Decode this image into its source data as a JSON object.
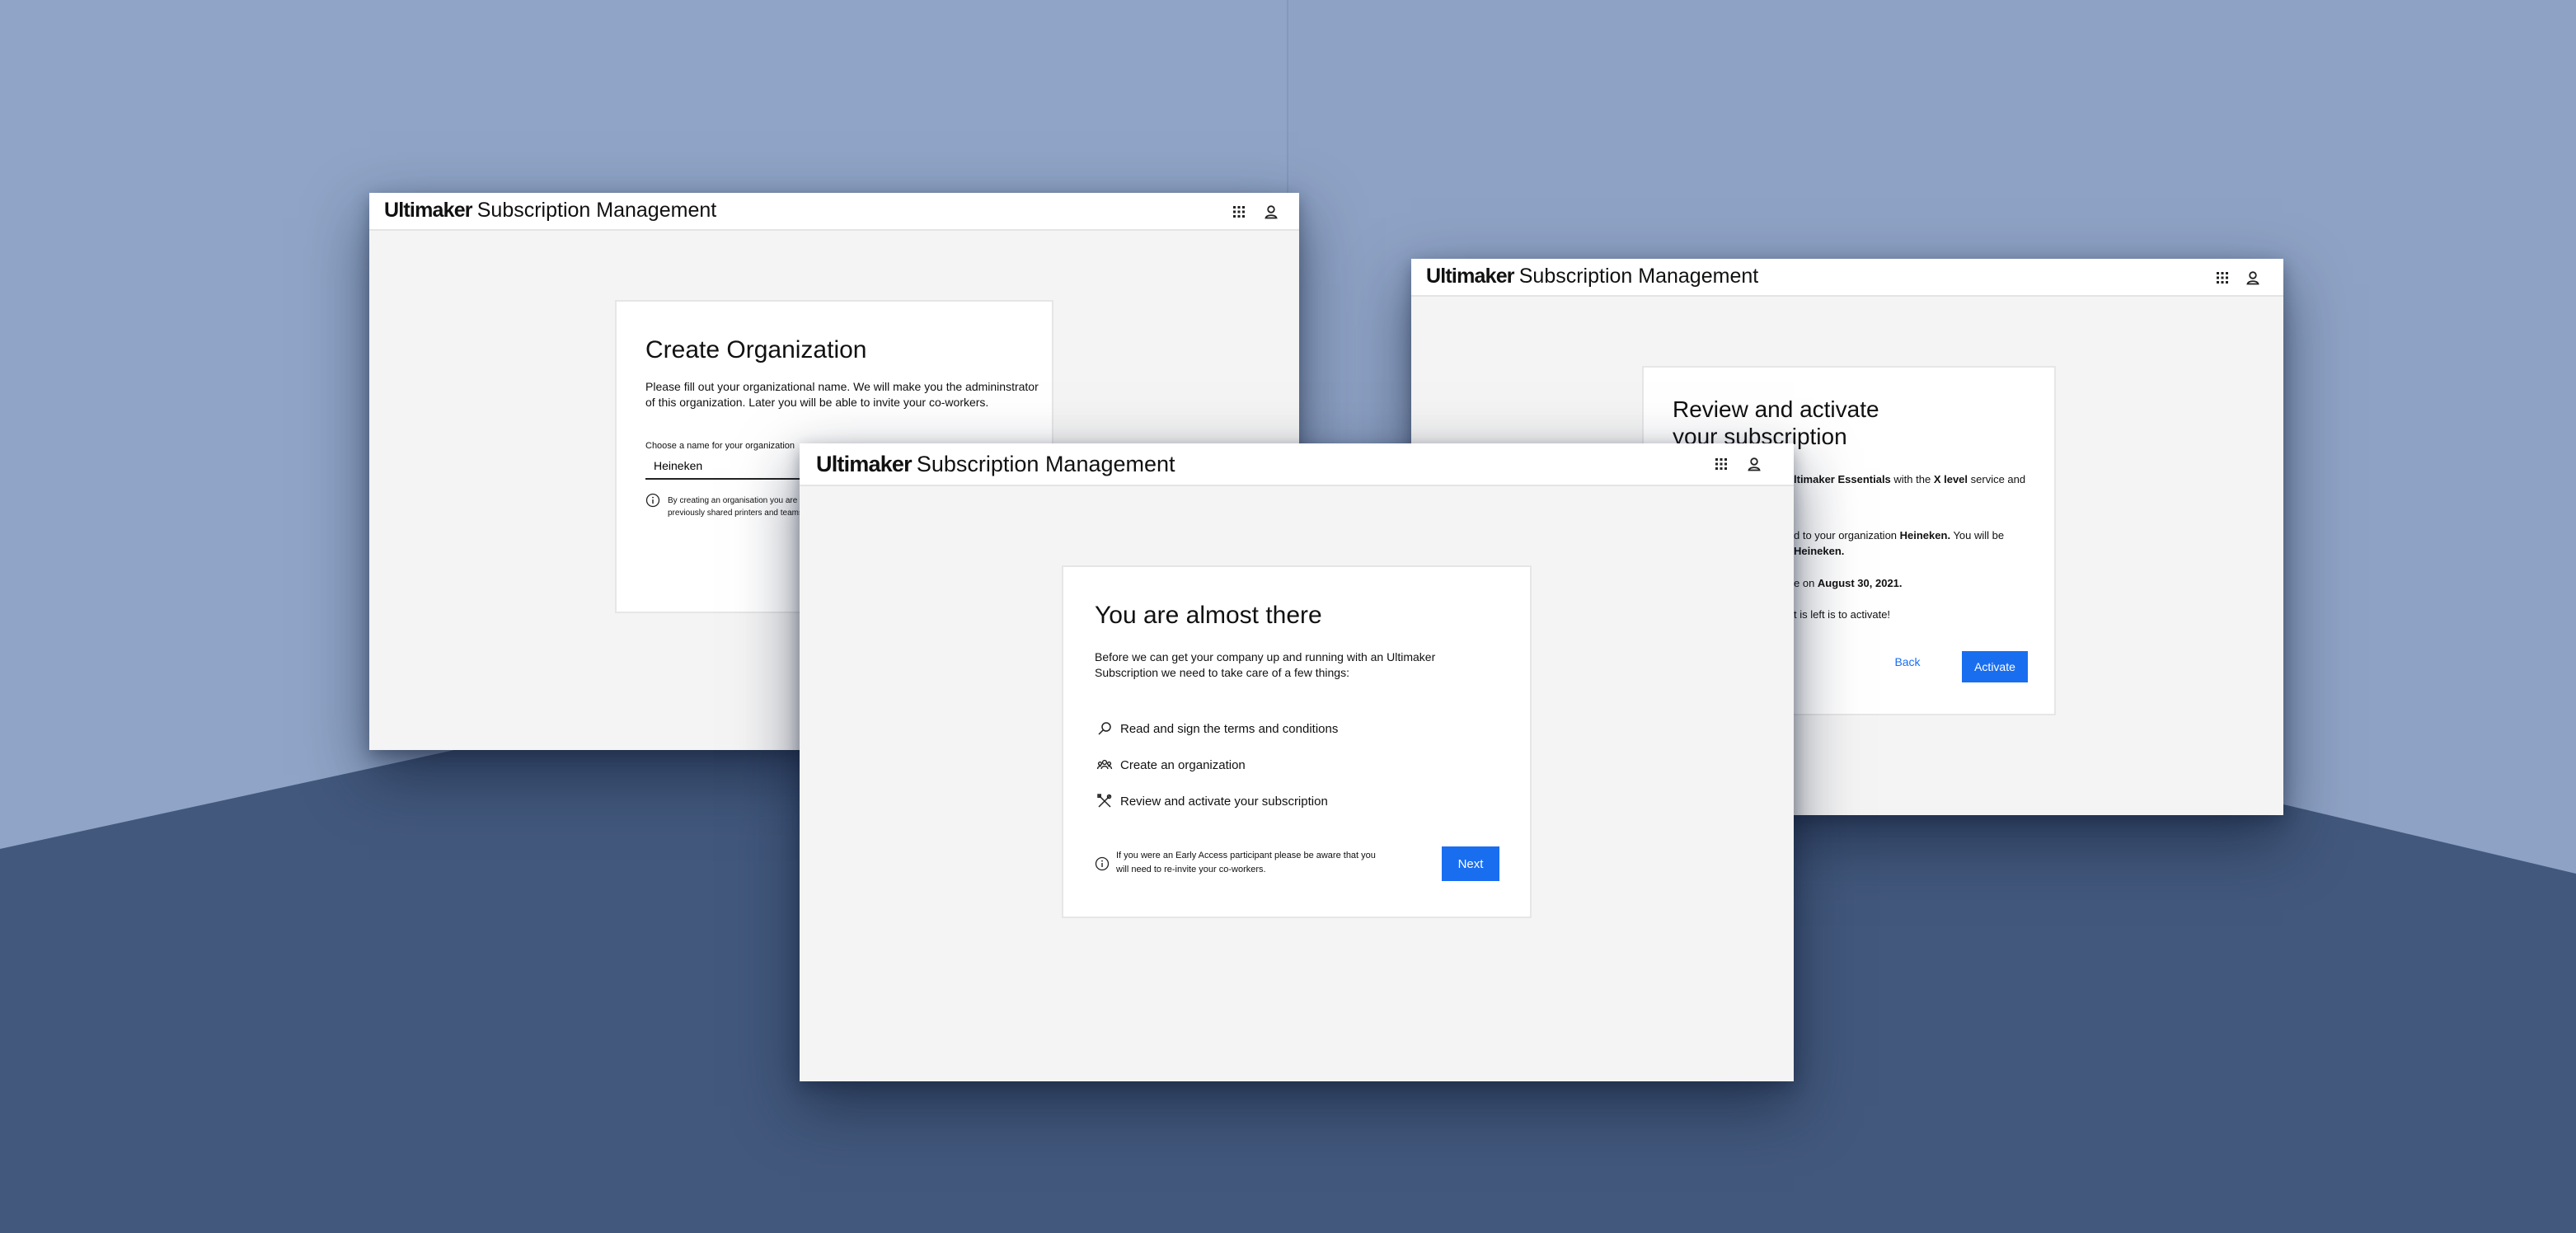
{
  "app": {
    "logo": "Ultimaker",
    "product": "Subscription Management"
  },
  "icons": {
    "apps": "grid-icon",
    "account": "user-icon",
    "info": "info-icon",
    "terms": "magnifier-icon",
    "organization": "people-icon",
    "activate": "tools-icon"
  },
  "colors": {
    "accent": "#196ef0",
    "background_top": "#8fa4c6",
    "background_bottom": "#42587c",
    "window": "#f4f4f4"
  },
  "create_org": {
    "title": "Create Organization",
    "description_line1": "Please fill out your organizational name. We will make you the admininstrator",
    "description_line2": "of this organization. Later you will be able to invite your co-workers.",
    "field_label": "Choose a name for your organization",
    "field_value": "Heineken",
    "note_line1": "By creating an organisation you are b",
    "note_line2": "previously shared printers and teams"
  },
  "review": {
    "title_line1": "Review and activate",
    "title_line2": "your subscription",
    "line1_a": "ltimaker Essentials",
    "line1_b": " with the ",
    "line1_c": "X level",
    "line1_d": " service and",
    "line2_a": "d to your organization ",
    "line2_b": "Heineken.",
    "line2_c": " You will be",
    "line3": "Heineken.",
    "line4_a": "e on ",
    "line4_b": "August 30, 2021.",
    "line5": "t is left is to activate!",
    "back_label": "Back",
    "activate_label": "Activate"
  },
  "almost": {
    "title": "You are almost there",
    "intro_line1": "Before we can get your company up and running with an Ultimaker",
    "intro_line2": "Subscription we need to take care of a few things:",
    "steps": [
      {
        "label": "Read and sign the terms and conditions"
      },
      {
        "label": "Create an organization"
      },
      {
        "label": "Review and activate your subscription"
      }
    ],
    "note_line1": "If you were an Early Access participant please be aware that you",
    "note_line2": "will need to re-invite your co-workers.",
    "next_label": "Next"
  }
}
